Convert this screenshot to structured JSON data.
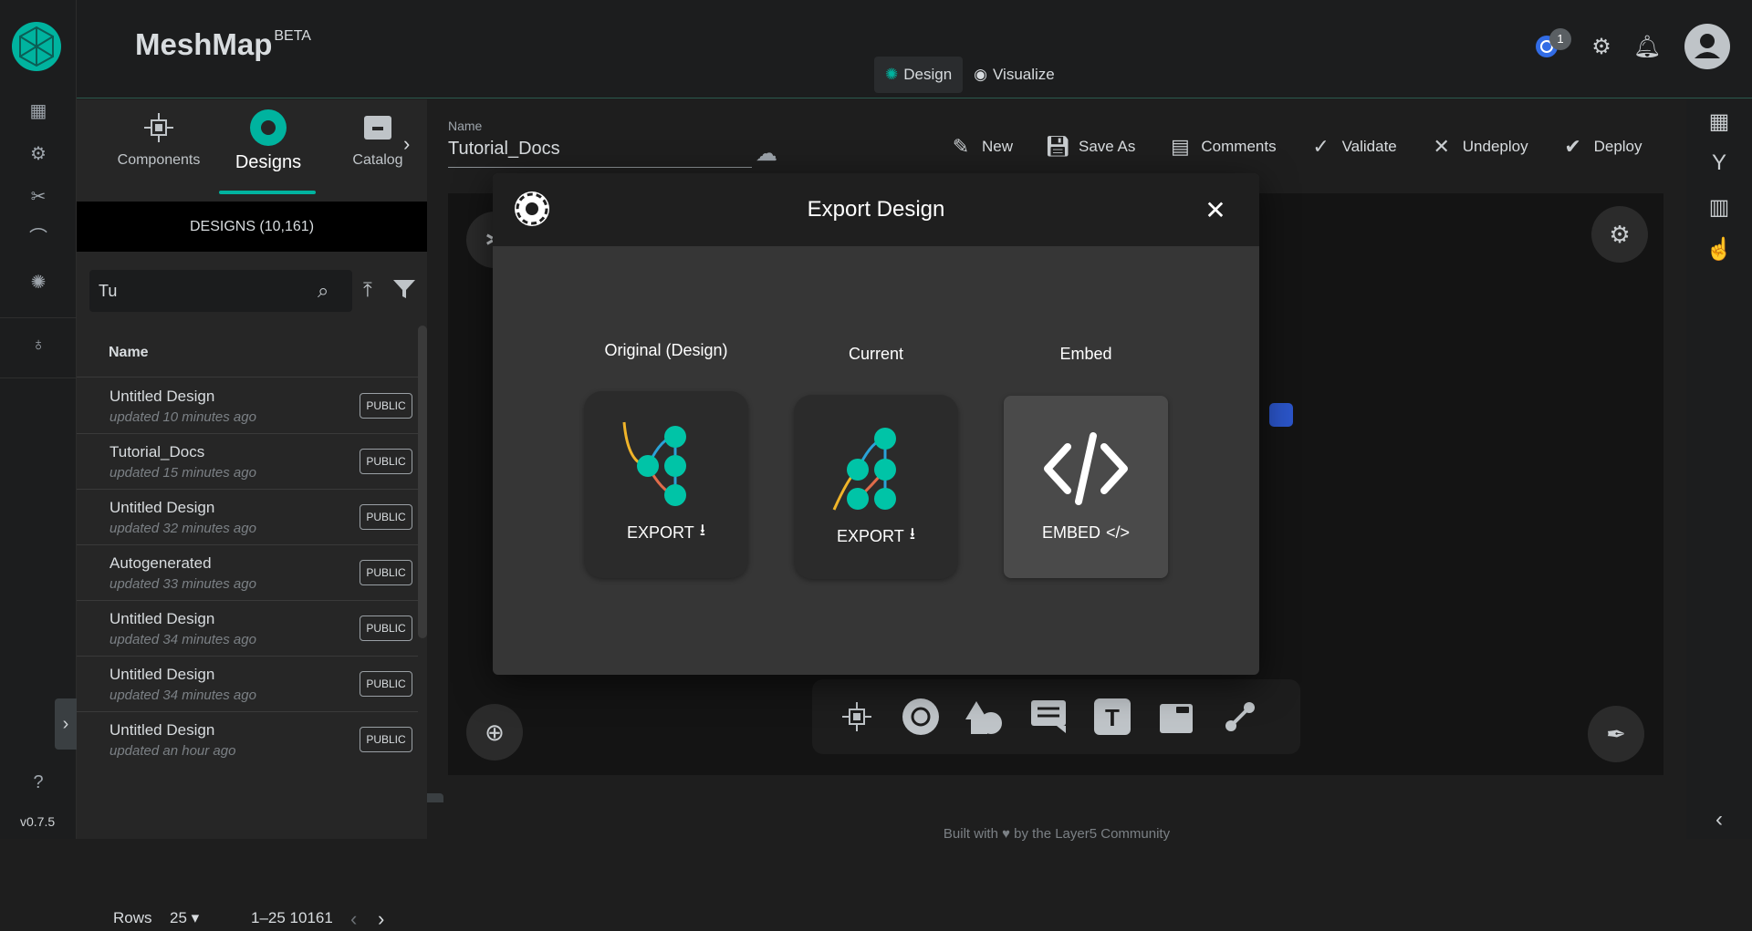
{
  "app": {
    "name": "MeshMap",
    "tag": "BETA",
    "version": "v0.7.5",
    "notif_count": "1"
  },
  "view_tabs": [
    {
      "label": "Design"
    },
    {
      "label": "Visualize"
    }
  ],
  "panel": {
    "tabs": [
      {
        "label": "Components"
      },
      {
        "label": "Designs"
      },
      {
        "label": "Catalog"
      }
    ],
    "header": "DESIGNS (10,161)",
    "search": {
      "value": "Tu",
      "placeholder": "Search"
    },
    "column": "Name",
    "rows": [
      {
        "title": "Untitled Design",
        "sub": "updated 10 minutes ago",
        "badge": "PUBLIC"
      },
      {
        "title": "Tutorial_Docs",
        "sub": "updated 15 minutes ago",
        "badge": "PUBLIC"
      },
      {
        "title": "Untitled Design",
        "sub": "updated 32 minutes ago",
        "badge": "PUBLIC"
      },
      {
        "title": "Autogenerated",
        "sub": "updated 33 minutes ago",
        "badge": "PUBLIC"
      },
      {
        "title": "Untitled Design",
        "sub": "updated 34 minutes ago",
        "badge": "PUBLIC"
      },
      {
        "title": "Untitled Design",
        "sub": "updated 34 minutes ago",
        "badge": "PUBLIC"
      },
      {
        "title": "Untitled Design",
        "sub": "updated an hour ago",
        "badge": "PUBLIC"
      }
    ],
    "pager": {
      "rows_label": "Rows",
      "rows_value": "25",
      "range": "1–25 10161"
    }
  },
  "design_name": {
    "label": "Name",
    "value": "Tutorial_Docs"
  },
  "toolbar": {
    "new": "New",
    "save_as": "Save As",
    "comments": "Comments",
    "validate": "Validate",
    "undeploy": "Undeploy",
    "deploy": "Deploy"
  },
  "footer": "Built with ♥ by the Layer5 Community",
  "modal": {
    "title": "Export Design",
    "options": [
      {
        "caption": "Original (Design)",
        "action": "EXPORT"
      },
      {
        "caption": "Current",
        "action": "EXPORT"
      },
      {
        "caption": "Embed",
        "action": "EMBED"
      }
    ]
  },
  "colors": {
    "accent": "#00b39f",
    "modal_bg": "#363636",
    "header_bg": "#1f1f1f"
  }
}
